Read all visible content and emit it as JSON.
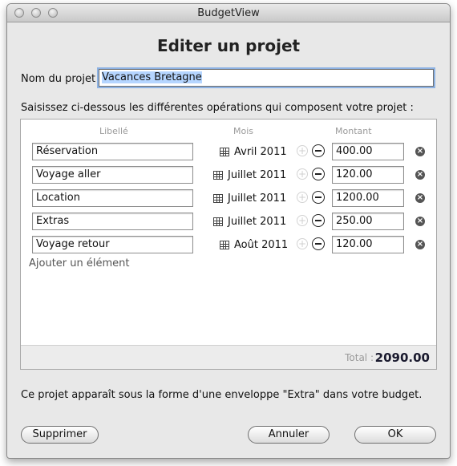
{
  "window": {
    "title": "BudgetView"
  },
  "dialog": {
    "title": "Editer un projet"
  },
  "project": {
    "name_label": "Nom du projet",
    "name_value": "Vacances Bretagne"
  },
  "instructions": "Saisissez ci-dessous les différentes opérations qui composent votre projet :",
  "table": {
    "headers": {
      "libelle": "Libellé",
      "mois": "Mois",
      "montant": "Montant"
    },
    "rows": [
      {
        "libelle": "Réservation",
        "mois": "Avril 2011",
        "montant": "400.00"
      },
      {
        "libelle": "Voyage aller",
        "mois": "Juillet 2011",
        "montant": "120.00"
      },
      {
        "libelle": "Location",
        "mois": "Juillet 2011",
        "montant": "1200.00"
      },
      {
        "libelle": "Extras",
        "mois": "Juillet 2011",
        "montant": "250.00"
      },
      {
        "libelle": "Voyage retour",
        "mois": "Août 2011",
        "montant": "120.00"
      }
    ],
    "add_item": "Ajouter un élément",
    "total_label": "Total :",
    "total_value": "2090.00"
  },
  "info": "Ce projet apparaît sous la forme d'une enveloppe \"Extra\" dans votre budget.",
  "buttons": {
    "delete": "Supprimer",
    "cancel": "Annuler",
    "ok": "OK"
  },
  "icons": {
    "calendar": "calendar-icon",
    "increment": "plus-circle-icon",
    "decrement": "minus-circle-icon",
    "remove": "x-circle-icon"
  }
}
